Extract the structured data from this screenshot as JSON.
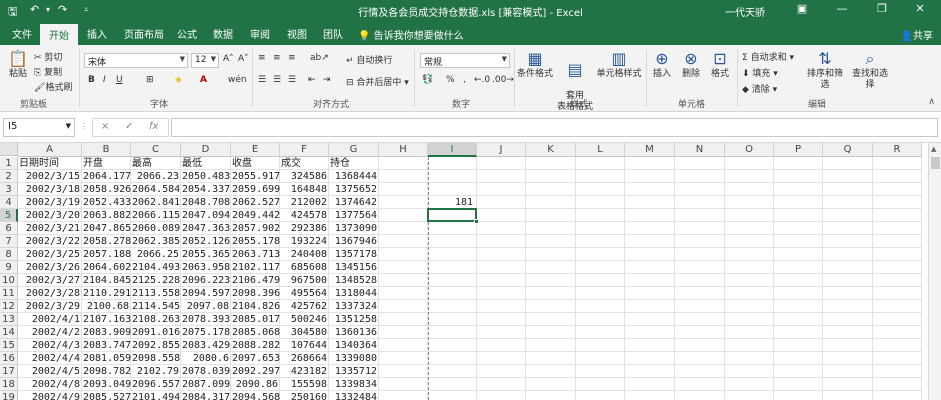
{
  "window": {
    "title": "行情及各会员成交持仓数据.xls [兼容模式] - Excel",
    "user": "一代天骄",
    "quick_access": [
      "save-icon",
      "undo-icon",
      "redo-icon",
      "customize-icon"
    ],
    "controls": [
      "ribbon-display-icon",
      "minimize-icon",
      "restore-icon",
      "close-icon"
    ]
  },
  "tabs": {
    "items": [
      "文件",
      "开始",
      "插入",
      "页面布局",
      "公式",
      "数据",
      "审阅",
      "视图",
      "团队"
    ],
    "active": "开始",
    "tell_me": "告诉我你想要做什么",
    "share": "共享"
  },
  "ribbon": {
    "clipboard": {
      "paste": "粘贴",
      "cut": "剪切",
      "copy": "复制",
      "format_painter": "格式刷",
      "label": "剪贴板"
    },
    "font": {
      "name": "宋体",
      "size": "12",
      "label": "字体"
    },
    "alignment": {
      "wrap": "自动换行",
      "merge": "合并后居中",
      "label": "对齐方式"
    },
    "number": {
      "format": "常规",
      "label": "数字"
    },
    "styles": {
      "conditional": "条件格式",
      "table": "套用\n表格格式",
      "cell_styles": "单元格样式",
      "label": "样式"
    },
    "cells": {
      "insert": "插入",
      "delete": "删除",
      "format": "格式",
      "label": "单元格"
    },
    "editing": {
      "autosum": "自动求和",
      "fill": "填充",
      "clear": "清除",
      "sort": "排序和筛选",
      "find": "查找和选择",
      "label": "编辑"
    }
  },
  "formula_bar": {
    "name_box": "I5",
    "cancel": "×",
    "enter": "✓",
    "fx": "fx",
    "content": ""
  },
  "sheet": {
    "columns": [
      "A",
      "B",
      "C",
      "D",
      "E",
      "F",
      "G",
      "H",
      "I",
      "J",
      "K",
      "L",
      "M",
      "N",
      "O",
      "P",
      "Q",
      "R"
    ],
    "selected_column": "I",
    "selected_row": "5",
    "row_numbers": [
      "1",
      "2",
      "3",
      "4",
      "5",
      "6",
      "7",
      "8",
      "9",
      "10",
      "11",
      "12",
      "13",
      "14",
      "15",
      "16",
      "17",
      "18",
      "19"
    ],
    "headers": [
      "日期时间",
      "开盘",
      "最高",
      "最低",
      "收盘",
      "成交",
      "持仓"
    ],
    "rows": [
      [
        "2002/3/15",
        "2064.177",
        "2066.23",
        "2050.483",
        "2055.917",
        "324586",
        "1368444"
      ],
      [
        "2002/3/18",
        "2058.926",
        "2064.584",
        "2054.337",
        "2059.699",
        "164848",
        "1375652"
      ],
      [
        "2002/3/19",
        "2052.433",
        "2062.841",
        "2048.708",
        "2062.527",
        "212002",
        "1374642"
      ],
      [
        "2002/3/20",
        "2063.882",
        "2066.115",
        "2047.094",
        "2049.442",
        "424578",
        "1377564"
      ],
      [
        "2002/3/21",
        "2047.865",
        "2060.089",
        "2047.363",
        "2057.902",
        "292386",
        "1373090"
      ],
      [
        "2002/3/22",
        "2058.278",
        "2062.385",
        "2052.126",
        "2055.178",
        "193224",
        "1367946"
      ],
      [
        "2002/3/25",
        "2057.188",
        "2066.25",
        "2055.365",
        "2063.713",
        "240408",
        "1357178"
      ],
      [
        "2002/3/26",
        "2064.602",
        "2104.493",
        "2063.958",
        "2102.117",
        "685608",
        "1345156"
      ],
      [
        "2002/3/27",
        "2104.845",
        "2125.228",
        "2096.223",
        "2106.479",
        "967500",
        "1348528"
      ],
      [
        "2002/3/28",
        "2110.291",
        "2113.558",
        "2094.597",
        "2098.396",
        "495564",
        "1318044"
      ],
      [
        "2002/3/29",
        "2100.68",
        "2114.545",
        "2097.08",
        "2104.826",
        "425762",
        "1337324"
      ],
      [
        "2002/4/1",
        "2107.163",
        "2108.263",
        "2078.393",
        "2085.017",
        "500246",
        "1351258"
      ],
      [
        "2002/4/2",
        "2083.909",
        "2091.016",
        "2075.178",
        "2085.068",
        "304580",
        "1360136"
      ],
      [
        "2002/4/3",
        "2083.747",
        "2092.855",
        "2083.429",
        "2088.282",
        "107644",
        "1340364"
      ],
      [
        "2002/4/4",
        "2081.059",
        "2098.558",
        "2080.6",
        "2097.653",
        "268664",
        "1339080"
      ],
      [
        "2002/4/5",
        "2098.782",
        "2102.79",
        "2078.039",
        "2092.297",
        "423182",
        "1335712"
      ],
      [
        "2002/4/8",
        "2093.049",
        "2096.557",
        "2087.099",
        "2090.86",
        "155598",
        "1339834"
      ],
      [
        "2002/4/9",
        "2085.527",
        "2101.494",
        "2084.317",
        "2094.568",
        "250160",
        "1332484"
      ]
    ],
    "extra_cell": {
      "ref": "I4",
      "value": "181"
    }
  }
}
